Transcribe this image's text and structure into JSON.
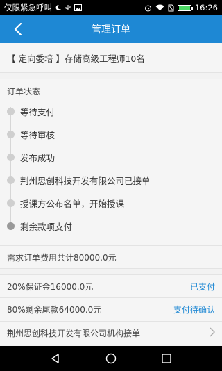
{
  "status_bar": {
    "carrier": "仅限紧急呼叫",
    "time": "16:26"
  },
  "app_bar": {
    "title": "管理订单"
  },
  "order": {
    "title": "【 定向委培 】存储高级工程师10名"
  },
  "status": {
    "heading": "订单状态",
    "steps": [
      {
        "label": "等待支付"
      },
      {
        "label": "等待审核"
      },
      {
        "label": "发布成功"
      },
      {
        "label": "荆州思创科技开发有限公司已接单"
      },
      {
        "label": "授课方公布名单，开始授课"
      },
      {
        "label": "剩余款项支付"
      }
    ]
  },
  "payments": {
    "total": "需求订单费用共计80000.0元",
    "deposit": {
      "label": "20%保证金16000.0元",
      "status": "已支付"
    },
    "balance": {
      "label": "80%剩余尾款64000.0元",
      "status": "支付待确认"
    },
    "company": {
      "label": "荆州思创科技开发有限公司机构接单"
    }
  },
  "colors": {
    "accent": "#1e88d4",
    "background": "#f2f2f2"
  }
}
